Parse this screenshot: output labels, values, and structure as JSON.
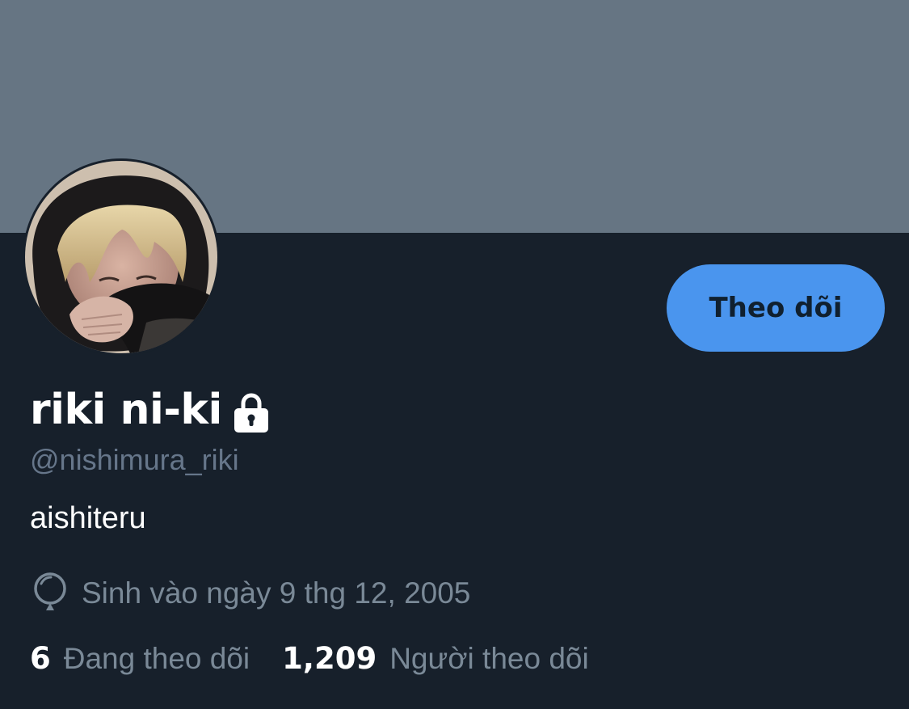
{
  "profile": {
    "display_name": "riki ni-ki",
    "handle": "@nishimura_riki",
    "bio": "aishiteru",
    "birthdate": "Sinh vào ngày 9 thg 12, 2005",
    "protected": true
  },
  "actions": {
    "follow_label": "Theo dõi"
  },
  "stats": {
    "following_count": "6",
    "following_label": "Đang theo dõi",
    "followers_count": "1,209",
    "followers_label": "Người theo dõi"
  },
  "icons": {
    "lock": "lock-icon",
    "birthday": "balloon-icon"
  },
  "colors": {
    "background": "#17202b",
    "banner": "#667583",
    "accent": "#4a95ee",
    "secondary_text": "#7a8997"
  }
}
